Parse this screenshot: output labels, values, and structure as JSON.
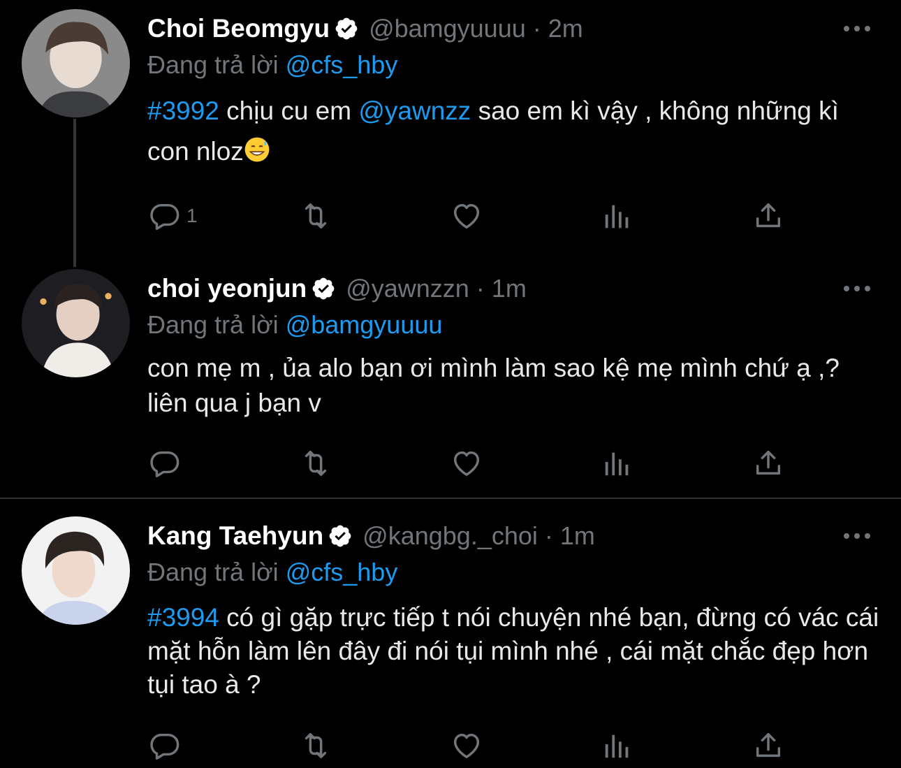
{
  "tweets": [
    {
      "name": "Choi Beomgyu",
      "handle": "@bamgyuuuu",
      "separator": "·",
      "time": "2m",
      "reply_prefix": "Đang trả lời",
      "reply_to": "@cfs_hby",
      "text_parts": {
        "p1": "#3992",
        "p2": " chịu cu em ",
        "p3": "@yawnzz",
        "p4": " sao em kì vậy , không những kì con nloz"
      },
      "reply_count": "1"
    },
    {
      "name": "choi yeonjun",
      "handle": "@yawnzzn",
      "separator": "·",
      "time": "1m",
      "reply_prefix": "Đang trả lời",
      "reply_to": "@bamgyuuuu",
      "text": "con mẹ m , ủa alo bạn ơi mình làm sao kệ mẹ mình chứ ạ ,? liên qua j bạn v"
    },
    {
      "name": "Kang Taehyun",
      "handle": "@kangbg._choi",
      "separator": "·",
      "time": "1m",
      "reply_prefix": "Đang trả lời",
      "reply_to": "@cfs_hby",
      "text_parts": {
        "p1": "#3994",
        "p2": " có gì gặp trực tiếp t nói chuyện nhé bạn, đừng có vác cái mặt hỗn làm lên đây đi nói tụi mình nhé , cái mặt chắc đẹp hơn tụi tao à ?"
      }
    }
  ],
  "icons": {
    "reply": "reply-icon",
    "retweet": "retweet-icon",
    "like": "heart-icon",
    "views": "views-icon",
    "share": "share-icon",
    "verified": "verified-badge-icon",
    "more": "more-icon"
  },
  "colors": {
    "background": "#000000",
    "link": "#1d9bf0",
    "muted": "#71767b"
  }
}
